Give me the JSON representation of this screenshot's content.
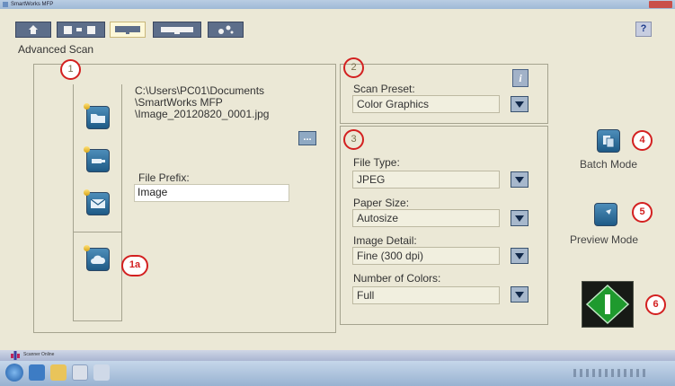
{
  "window": {
    "title": "SmartWorks MFP"
  },
  "toolbar": {
    "tabs": [
      {
        "icon": "home-icon"
      },
      {
        "icon": "copy-icon"
      },
      {
        "icon": "scan-icon",
        "active": true
      },
      {
        "icon": "print-icon"
      },
      {
        "icon": "settings-icon"
      }
    ],
    "help_label": "?"
  },
  "page_title": "Advanced Scan",
  "destination": {
    "path": "C:\\Users\\PC01\\Documents\n\\SmartWorks MFP\n\\Image_20120820_0001.jpg",
    "browse_label": "...",
    "file_prefix_label": "File Prefix:",
    "file_prefix_value": "Image",
    "buttons": [
      "folder-icon",
      "usb-icon",
      "email-icon",
      "cloud-icon"
    ]
  },
  "scan_preset": {
    "label": "Scan Preset:",
    "value": "Color Graphics",
    "info_label": "i"
  },
  "settings": {
    "file_type": {
      "label": "File Type:",
      "value": "JPEG"
    },
    "paper_size": {
      "label": "Paper Size:",
      "value": "Autosize"
    },
    "image_detail": {
      "label": "Image Detail:",
      "value": "Fine (300 dpi)"
    },
    "colors": {
      "label": "Number of Colors:",
      "value": "Full"
    }
  },
  "actions": {
    "batch_label": "Batch Mode",
    "preview_label": "Preview Mode"
  },
  "callouts": {
    "c1": "1",
    "c1a": "1a",
    "c2": "2",
    "c3": "3",
    "c4": "4",
    "c5": "5",
    "c6": "6"
  },
  "status_bar": {
    "text": "Scanner Online"
  },
  "colors": {
    "background": "#ebe8d6",
    "button_blue": "#1e5a86",
    "callout_red": "#d32020",
    "start_green": "#1f9a2e"
  }
}
